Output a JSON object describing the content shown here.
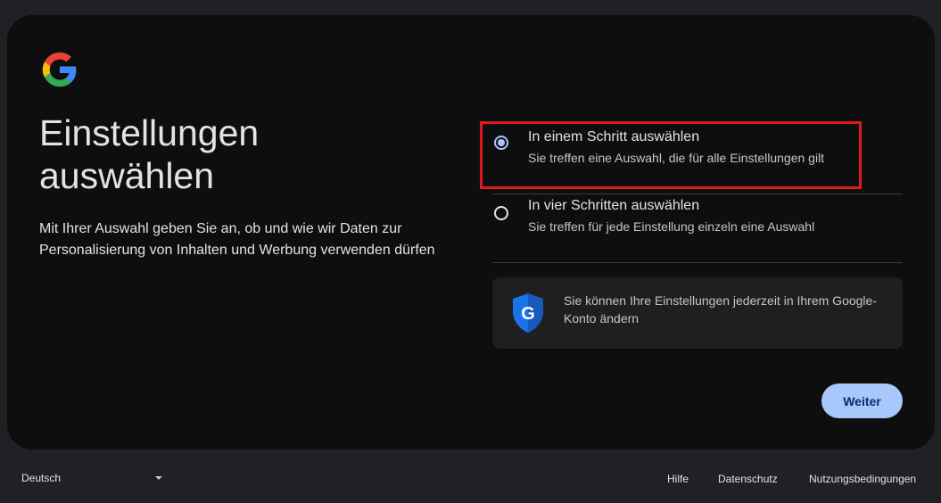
{
  "header": {
    "logo": "google-g-logo",
    "title_line1": "Einstellungen",
    "title_line2": "auswählen",
    "subtitle": "Mit Ihrer Auswahl geben Sie an, ob und wie wir Daten zur Personalisierung von Inhalten und Werbung verwenden dürfen"
  },
  "options": [
    {
      "label": "In einem Schritt auswählen",
      "description": "Sie treffen eine Auswahl, die für alle Einstellungen gilt",
      "selected": true
    },
    {
      "label": "In vier Schritten auswählen",
      "description": "Sie treffen für jede Einstellung einzeln eine Auswahl",
      "selected": false
    }
  ],
  "info": {
    "icon": "google-shield-icon",
    "text": "Sie können Ihre Einstellungen jederzeit in Ihrem Google-Konto ändern"
  },
  "actions": {
    "next_label": "Weiter"
  },
  "footer": {
    "language": "Deutsch",
    "links": [
      "Hilfe",
      "Datenschutz",
      "Nutzungsbedingungen"
    ]
  },
  "colors": {
    "accent": "#a8c7fa",
    "highlight": "#e0191f",
    "background": "#0e0e0f"
  }
}
